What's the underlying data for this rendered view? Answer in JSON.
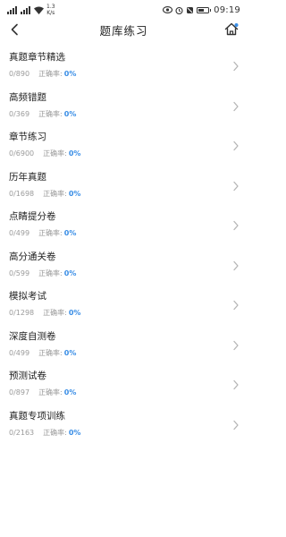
{
  "status_bar": {
    "net_speed_value": "1.3",
    "net_speed_unit": "K/s",
    "battery_level": 0.6,
    "time": "09:19"
  },
  "nav": {
    "title": "题库练习"
  },
  "items": [
    {
      "title": "真题章节精选",
      "progress": "0/890",
      "rate_label": "正确率:",
      "rate_value": "0%"
    },
    {
      "title": "高频错题",
      "progress": "0/369",
      "rate_label": "正确率:",
      "rate_value": "0%"
    },
    {
      "title": "章节练习",
      "progress": "0/6900",
      "rate_label": "正确率:",
      "rate_value": "0%"
    },
    {
      "title": "历年真题",
      "progress": "0/1698",
      "rate_label": "正确率:",
      "rate_value": "0%"
    },
    {
      "title": "点睛提分卷",
      "progress": "0/499",
      "rate_label": "正确率:",
      "rate_value": "0%"
    },
    {
      "title": "高分通关卷",
      "progress": "0/599",
      "rate_label": "正确率:",
      "rate_value": "0%"
    },
    {
      "title": "模拟考试",
      "progress": "0/1298",
      "rate_label": "正确率:",
      "rate_value": "0%"
    },
    {
      "title": "深度自测卷",
      "progress": "0/499",
      "rate_label": "正确率:",
      "rate_value": "0%"
    },
    {
      "title": "预测试卷",
      "progress": "0/897",
      "rate_label": "正确率:",
      "rate_value": "0%"
    },
    {
      "title": "真题专项训练",
      "progress": "0/2163",
      "rate_label": "正确率:",
      "rate_value": "0%"
    }
  ],
  "colors": {
    "accent": "#3a8ee6",
    "meta_text": "#9a9a9a",
    "chevron": "#b5b5b5"
  }
}
